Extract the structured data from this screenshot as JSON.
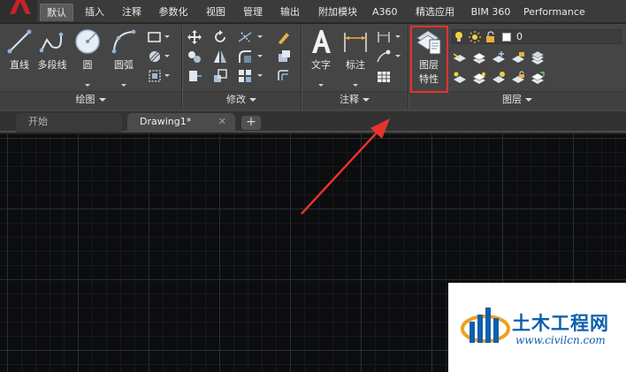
{
  "menu": {
    "tabs": [
      "默认",
      "插入",
      "注释",
      "参数化",
      "视图",
      "管理",
      "输出",
      "附加模块",
      "A360",
      "精选应用",
      "BIM 360",
      "Performance"
    ],
    "active": "默认"
  },
  "ribbon": {
    "draw": {
      "title": "绘图",
      "line": "直线",
      "polyline": "多段线",
      "circle": "圆",
      "arc": "圆弧"
    },
    "modify": {
      "title": "修改"
    },
    "annotation": {
      "title": "注释",
      "text": "文字",
      "dimension": "标注"
    },
    "layers": {
      "title": "图层",
      "properties_line1": "图层",
      "properties_line2": "特性",
      "current_layer": "0"
    }
  },
  "filetabs": {
    "start": "开始",
    "drawing": "Drawing1*",
    "close": "✕",
    "add": "+"
  },
  "watermark": {
    "title": "土木工程网",
    "url": "www.civilcn.com"
  },
  "colors": {
    "highlight": "#e8332c",
    "ribbon_bg": "#454545",
    "canvas_bg": "#0c0d0f",
    "watermark_blue": "#0f5fae"
  }
}
